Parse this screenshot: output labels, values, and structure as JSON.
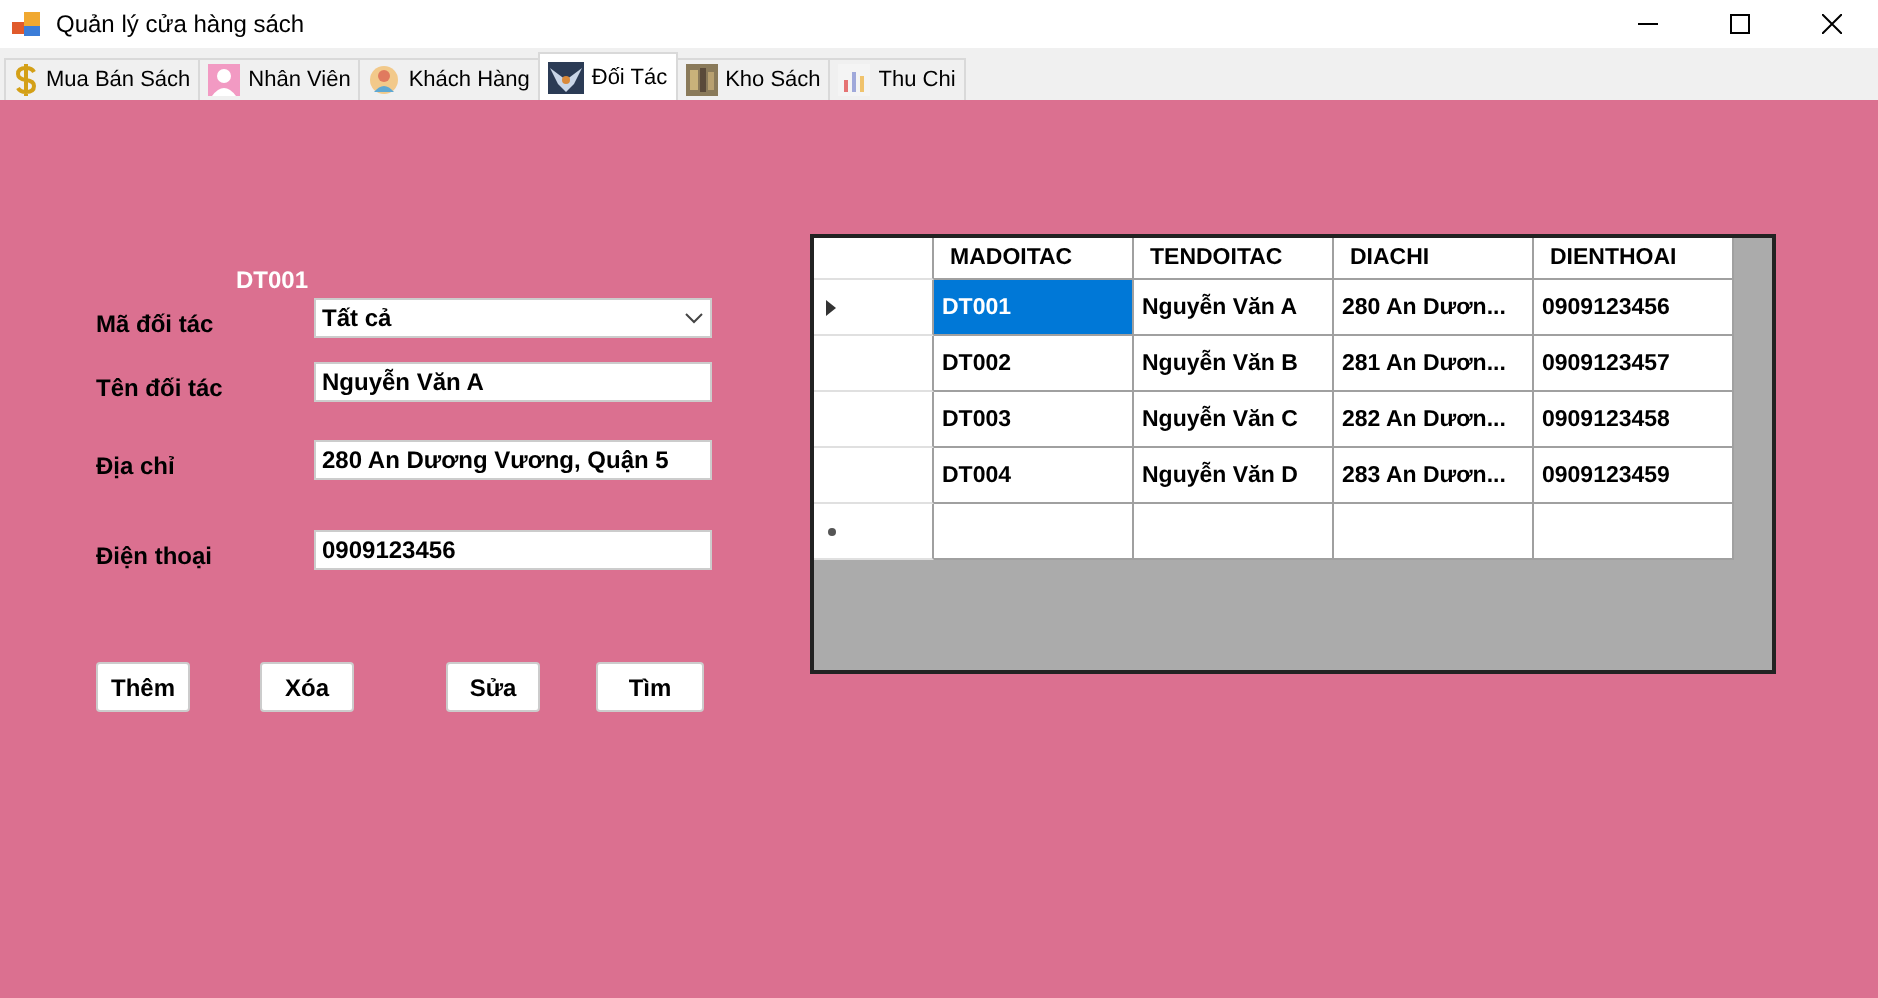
{
  "window": {
    "title": "Quản lý cửa hàng sách"
  },
  "tabs": [
    {
      "label": "Mua Bán Sách",
      "selected": false
    },
    {
      "label": "Nhân Viên",
      "selected": false
    },
    {
      "label": "Khách Hàng",
      "selected": false
    },
    {
      "label": "Đối Tác",
      "selected": true
    },
    {
      "label": "Kho Sách",
      "selected": false
    },
    {
      "label": "Thu Chi",
      "selected": false
    }
  ],
  "form": {
    "current_id": "DT001",
    "fields": [
      {
        "label": "Mã đối tác",
        "kind": "dropdown",
        "value": "Tất cả"
      },
      {
        "label": "Tên đối tác",
        "kind": "text",
        "value": "Nguyễn Văn A"
      },
      {
        "label": "Địa chỉ",
        "kind": "text",
        "value": "280 An Dương Vương, Quận 5"
      },
      {
        "label": "Điện thoại",
        "kind": "text",
        "value": "0909123456"
      }
    ],
    "buttons": [
      "Thêm",
      "Xóa",
      "Sửa",
      "Tìm"
    ]
  },
  "table": {
    "columns": [
      "MADOITAC",
      "TENDOITAC",
      "DIACHI",
      "DIENTHOAI"
    ],
    "rows": [
      {
        "selected": true,
        "cells": [
          "DT001",
          "Nguyễn Văn A",
          "280 An Dươn...",
          "0909123456"
        ]
      },
      {
        "selected": false,
        "cells": [
          "DT002",
          "Nguyễn Văn B",
          "281 An Dươn...",
          "0909123457"
        ]
      },
      {
        "selected": false,
        "cells": [
          "DT003",
          "Nguyễn Văn C",
          "282 An Dươn...",
          "0909123458"
        ]
      },
      {
        "selected": false,
        "cells": [
          "DT004",
          "Nguyễn Văn D",
          "283 An Dươn...",
          "0909123459"
        ]
      }
    ]
  }
}
